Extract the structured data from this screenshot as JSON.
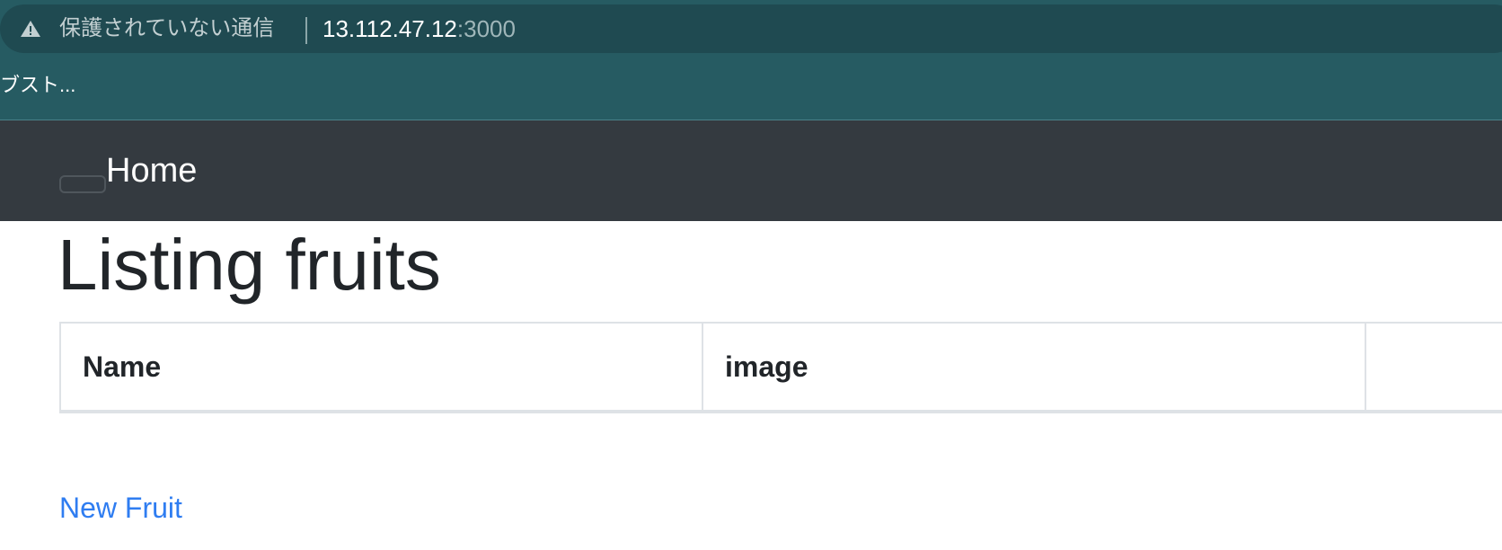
{
  "browser": {
    "security_label": "保護されていない通信",
    "url_host": "13.112.47.12",
    "url_port": ":3000",
    "bookmark_label": "ブスト..."
  },
  "navbar": {
    "home_label": "Home"
  },
  "main": {
    "title": "Listing fruits",
    "table": {
      "columns": [
        "Name",
        "image",
        ""
      ]
    },
    "new_link_label": "New Fruit"
  },
  "colors": {
    "chrome_bg": "#265b62",
    "address_bar_bg": "#1f4a51",
    "navbar_bg": "#343a40",
    "link": "#2f7df1",
    "text": "#212529"
  },
  "icons": {
    "security": "warning-triangle-icon"
  }
}
